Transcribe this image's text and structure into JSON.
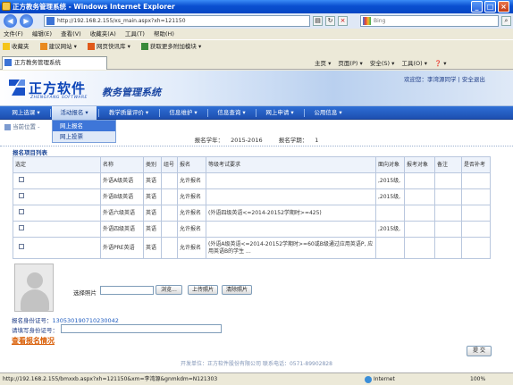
{
  "window": {
    "title": "正方教务管理系统 - Windows Internet Explorer"
  },
  "address": {
    "url": "http://192.168.2.155/xs_main.aspx?xh=121150",
    "search_placeholder": "Bing"
  },
  "menubar": [
    "文件(F)",
    "编辑(E)",
    "查看(V)",
    "收藏夹(A)",
    "工具(T)",
    "帮助(H)"
  ],
  "favbar": [
    "收藏夹",
    "建议网站 ▾",
    "网页快讯库 ▾",
    "获取更多附加模块 ▾"
  ],
  "tab": {
    "label": "正方教务管理系统"
  },
  "commandbar": [
    "主页 ▾",
    "页面(P) ▾",
    "安全(S) ▾",
    "工具(O) ▾",
    "❓ ▾"
  ],
  "header": {
    "logo_cn": "正方软件",
    "logo_en": "ZHENGFANG SOFTWARE",
    "system_title": "教务管理系统",
    "welcome": "欢迎您：李湾源同学 | 安全退出"
  },
  "nav": {
    "items": [
      "网上选课 ▾",
      "活动报名 ▾",
      "教学质量评价 ▾",
      "信息维护 ▾",
      "信息查询 ▾",
      "网上申请 ▾",
      "公用信息 ▾"
    ],
    "dropdown": [
      "网上报名",
      "网上投票"
    ]
  },
  "breadcrumb": "当前位置 -",
  "academic": {
    "year_label": "报名学年：",
    "year": "2015-2016",
    "term_label": "报名学期：",
    "term": "1"
  },
  "section_title": "报名项目列表",
  "table": {
    "headers": [
      "选定",
      "名称",
      "类别",
      "组号",
      "报名",
      "等级考试要求",
      "面向对象",
      "报考对象",
      "备注",
      "是否补考"
    ],
    "rows": [
      [
        "",
        "外语A级英语",
        "英语",
        "",
        "允许报名",
        "",
        ",2015级,",
        "",
        "",
        ""
      ],
      [
        "",
        "外语B级英语",
        "英语",
        "",
        "允许报名",
        "",
        ",2015级,",
        "",
        "",
        ""
      ],
      [
        "",
        "外语六级英语",
        "英语",
        "",
        "允许报名",
        "(外语四级英语<=2014-20152学期时>=425)",
        "",
        "",
        "",
        ""
      ],
      [
        "",
        "外语四级英语",
        "英语",
        "",
        "允许报名",
        "",
        ",2015级,",
        "",
        "",
        ""
      ],
      [
        "",
        "外语PRE英语",
        "英语",
        "",
        "允许报名",
        "(外语A级英语<=2014-20152学期时>=60或B级通过应用英语P, 应用英语B的学生 ...",
        "",
        "",
        "",
        ""
      ]
    ]
  },
  "photo": {
    "label": "选择照片",
    "browse": "浏览...",
    "upload": "上传照片",
    "clear": "清除照片"
  },
  "id_info": {
    "label": "报名身份证号：",
    "value": "130530190710230042",
    "edit_label": "请填写身份证号："
  },
  "view_link": "查看报名情况",
  "submit": "提 交",
  "footer": "开发单位：正方软件股份有限公司 联系电话：0571-89902828",
  "status": {
    "url": "http://192.168.2.155/bmxxb.aspx?xh=121150&xm=李湾源&gnmkdm=N121303",
    "zone": "Internet",
    "zoom": "100%"
  }
}
